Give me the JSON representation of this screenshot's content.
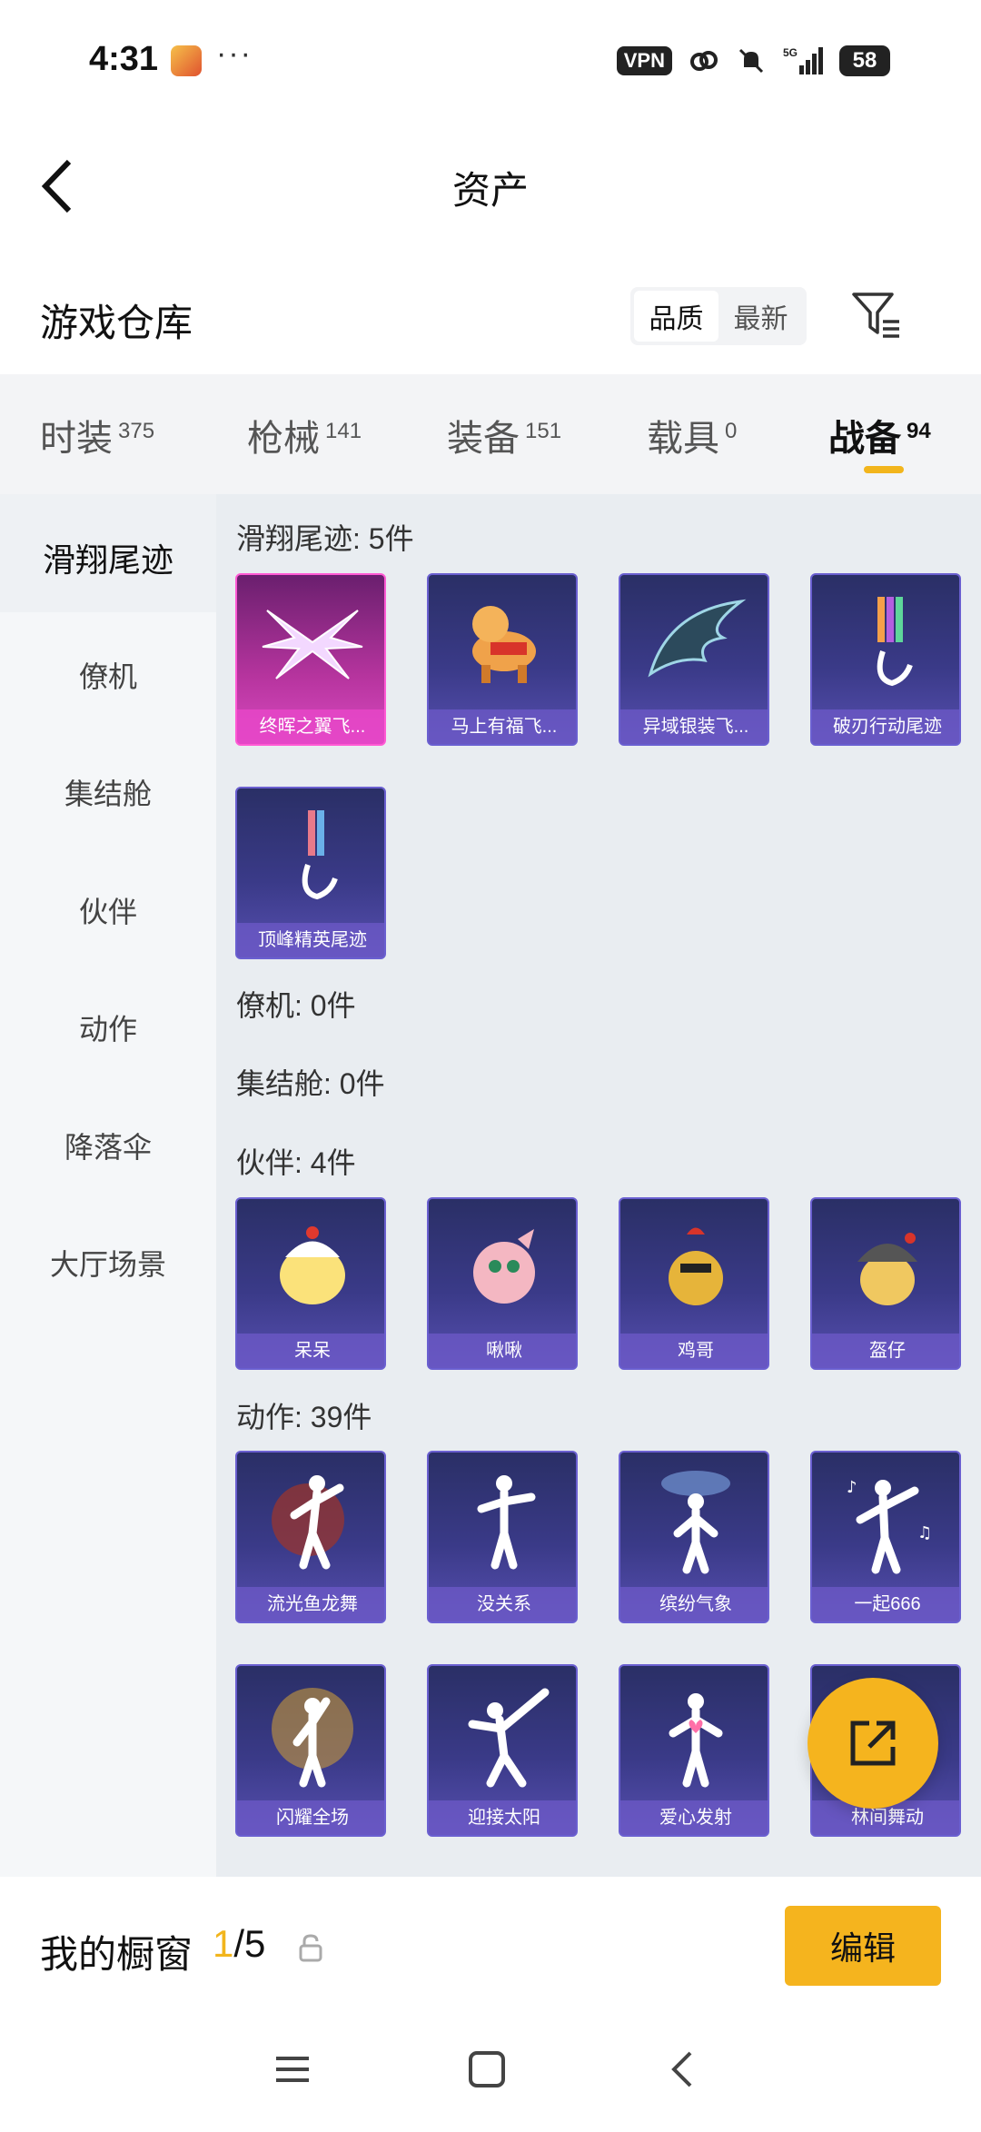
{
  "status_bar": {
    "time": "4:31",
    "dots": "···",
    "vpn": "VPN",
    "network": "5G",
    "battery": "58"
  },
  "header": {
    "title": "资产"
  },
  "warehouse": {
    "title": "游戏仓库",
    "sort_options": [
      "品质",
      "最新"
    ],
    "active_sort": "品质"
  },
  "tabs": [
    {
      "label": "时装",
      "count": "375"
    },
    {
      "label": "枪械",
      "count": "141"
    },
    {
      "label": "装备",
      "count": "151"
    },
    {
      "label": "载具",
      "count": "0"
    },
    {
      "label": "战备",
      "count": "94"
    }
  ],
  "active_tab": "战备",
  "sidebar": {
    "items": [
      "滑翔尾迹",
      "僚机",
      "集结舱",
      "伙伴",
      "动作",
      "降落伞",
      "大厅场景"
    ],
    "active": "滑翔尾迹"
  },
  "groups": {
    "glide": {
      "title": "滑翔尾迹: 5件",
      "items": [
        "终晖之翼飞...",
        "马上有福飞...",
        "异域银装飞...",
        "破刃行动尾迹",
        "顶峰精英尾迹"
      ]
    },
    "wingman": {
      "title": "僚机: 0件"
    },
    "pod": {
      "title": "集结舱: 0件"
    },
    "partner": {
      "title": "伙伴: 4件",
      "items": [
        "呆呆",
        "啾啾",
        "鸡哥",
        "盔仔"
      ]
    },
    "emote": {
      "title": "动作: 39件",
      "items": [
        "流光鱼龙舞",
        "没关系",
        "缤纷气象",
        "一起666",
        "闪耀全场",
        "迎接太阳",
        "爱心发射",
        "林间舞动"
      ]
    }
  },
  "showcase": {
    "label": "我的橱窗",
    "current": "1",
    "total": "/5",
    "edit_label": "编辑"
  },
  "colors": {
    "accent": "#f5b41e",
    "card_bg": "#3a3a88",
    "card_highlight": "#d94ac0"
  }
}
